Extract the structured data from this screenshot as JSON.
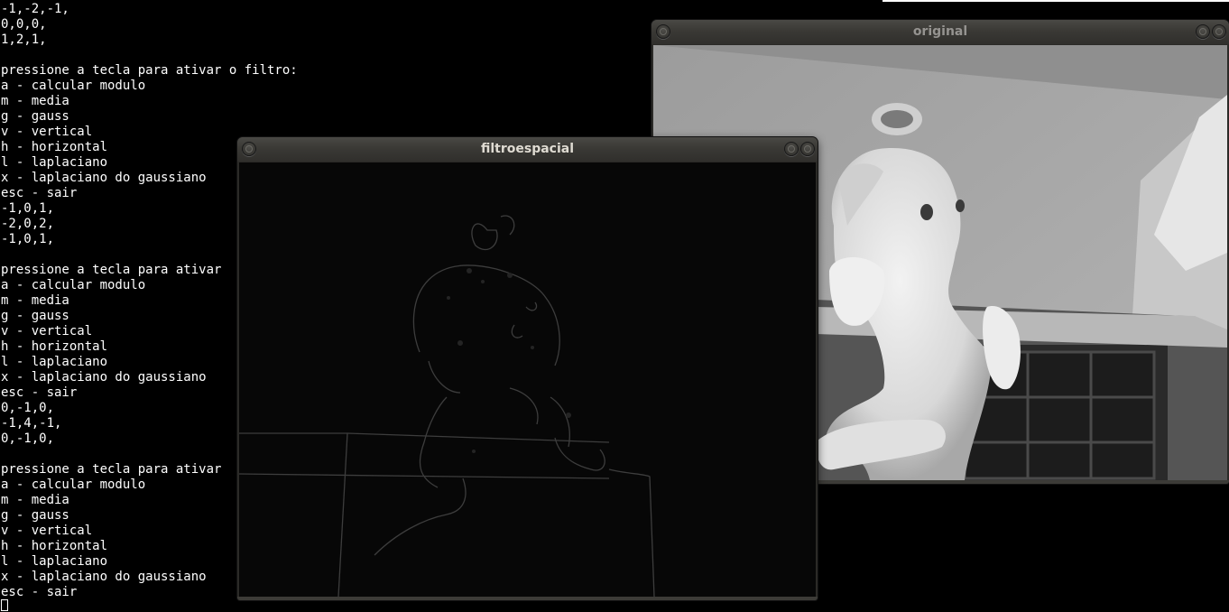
{
  "terminal": {
    "lines": [
      "-1,-2,-1,",
      "0,0,0,",
      "1,2,1,",
      "",
      "pressione a tecla para ativar o filtro:",
      "a - calcular modulo",
      "m - media",
      "g - gauss",
      "v - vertical",
      "h - horizontal",
      "l - laplaciano",
      "x - laplaciano do gaussiano",
      "esc - sair",
      "-1,0,1,",
      "-2,0,2,",
      "-1,0,1,",
      "",
      "pressione a tecla para ativar",
      "a - calcular modulo",
      "m - media",
      "g - gauss",
      "v - vertical",
      "h - horizontal",
      "l - laplaciano",
      "x - laplaciano do gaussiano",
      "esc - sair",
      "0,-1,0,",
      "-1,4,-1,",
      "0,-1,0,",
      "",
      "pressione a tecla para ativar",
      "a - calcular modulo",
      "m - media",
      "g - gauss",
      "v - vertical",
      "h - horizontal",
      "l - laplaciano",
      "x - laplaciano do gaussiano",
      "esc - sair"
    ]
  },
  "windows": {
    "original": {
      "title": "original"
    },
    "filtro": {
      "title": "filtroespacial"
    }
  },
  "colors": {
    "terminal_bg": "#000000",
    "terminal_fg": "#ffffff",
    "titlebar": "#3c3b37",
    "active_title": "#dfdbd2",
    "inactive_title": "#959390"
  },
  "icons": {
    "close": "close-icon",
    "minimize": "minimize-icon",
    "maximize": "maximize-icon"
  }
}
